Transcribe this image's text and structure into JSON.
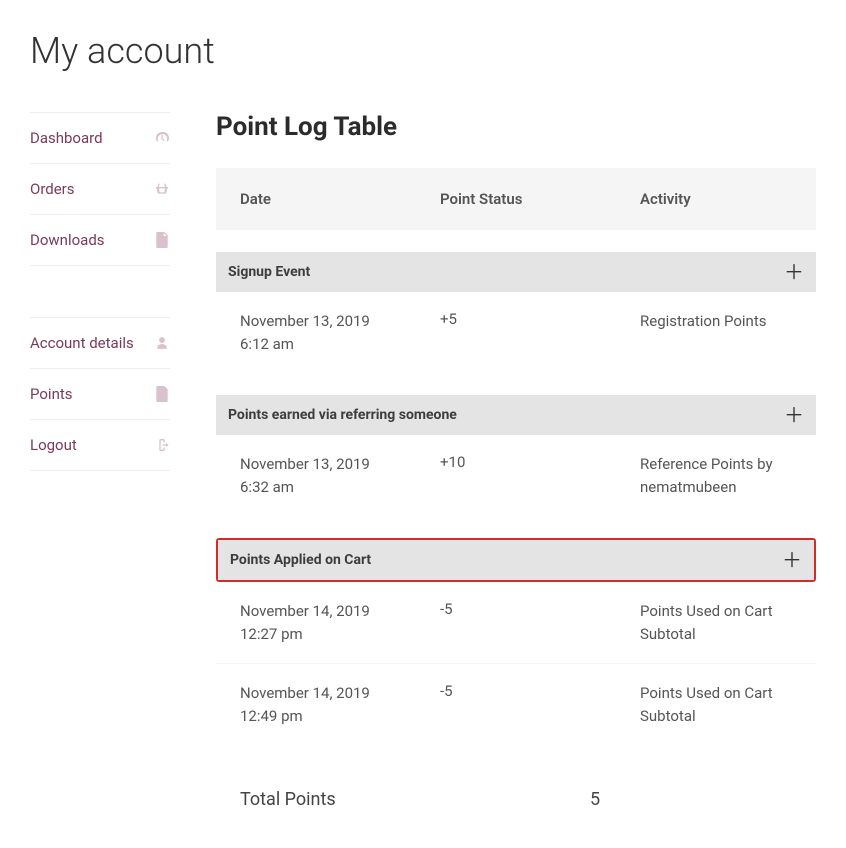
{
  "page_title": "My account",
  "sidebar": {
    "items": [
      {
        "label": "Dashboard",
        "icon": "dashboard-icon"
      },
      {
        "label": "Orders",
        "icon": "basket-icon"
      },
      {
        "label": "Downloads",
        "icon": "file-icon"
      },
      {
        "label": "",
        "icon": ""
      },
      {
        "label": "Account details",
        "icon": "user-icon"
      },
      {
        "label": "Points",
        "icon": "doc-icon"
      },
      {
        "label": "Logout",
        "icon": "signout-icon"
      }
    ]
  },
  "main": {
    "title": "Point Log Table",
    "columns": {
      "date": "Date",
      "status": "Point Status",
      "activity": "Activity"
    },
    "groups": [
      {
        "title": "Signup Event",
        "highlighted": false,
        "rows": [
          {
            "date": "November 13, 2019 6:12 am",
            "status": "+5",
            "activity": "Registration Points"
          }
        ]
      },
      {
        "title": "Points earned via referring someone",
        "highlighted": false,
        "rows": [
          {
            "date": "November 13, 2019 6:32 am",
            "status": "+10",
            "activity": "Reference Points by nematmubeen"
          }
        ]
      },
      {
        "title": "Points Applied on Cart",
        "highlighted": true,
        "rows": [
          {
            "date": "November 14, 2019 12:27 pm",
            "status": "-5",
            "activity": "Points Used on Cart Subtotal"
          },
          {
            "date": "November 14, 2019 12:49 pm",
            "status": "-5",
            "activity": "Points Used on Cart Subtotal"
          }
        ]
      }
    ],
    "total": {
      "label": "Total Points",
      "value": "5"
    }
  }
}
